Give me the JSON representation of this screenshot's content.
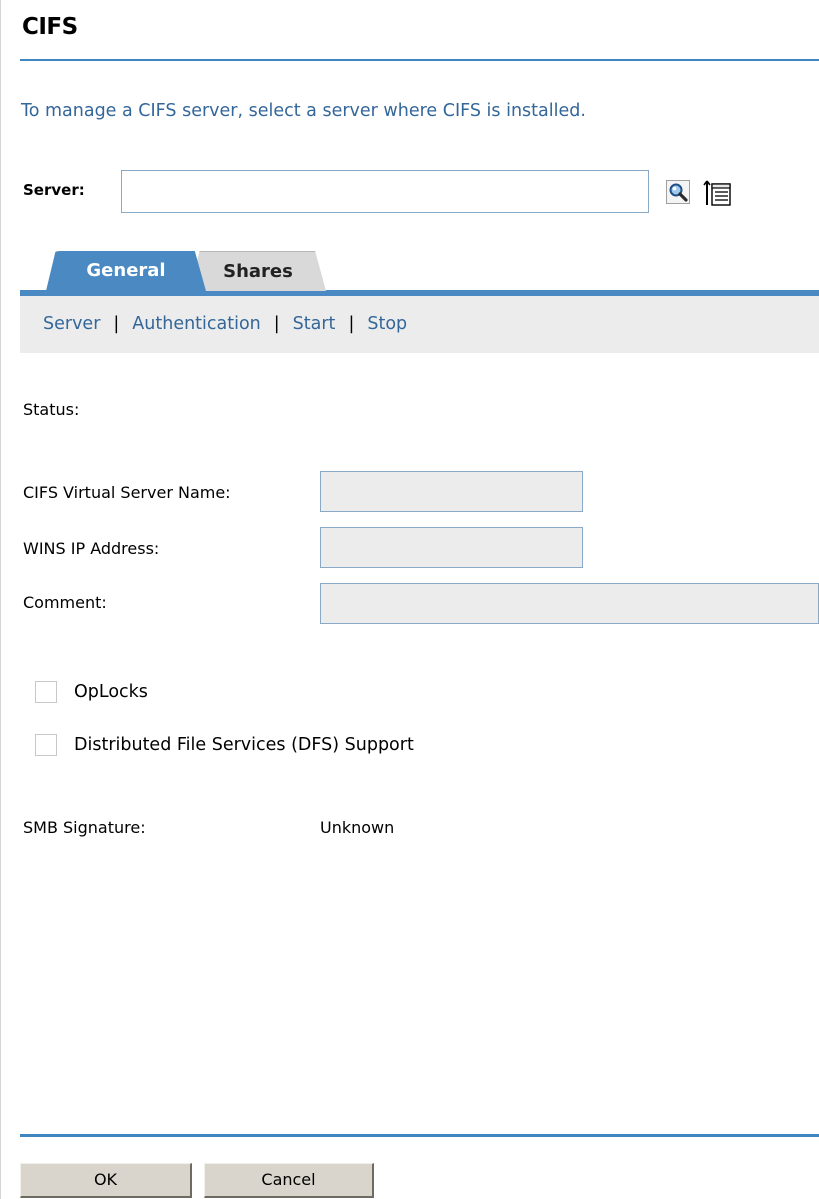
{
  "page": {
    "title": "CIFS",
    "instructions": "To manage a CIFS server, select a server where CIFS is installed."
  },
  "server": {
    "label": "Server:",
    "value": "",
    "search_icon": "magnifier-search-icon",
    "browse_icon": "object-browser-tree-icon"
  },
  "tabs": [
    {
      "label": "General",
      "active": true
    },
    {
      "label": "Shares",
      "active": false
    }
  ],
  "subnav": {
    "items": [
      "Server",
      "Authentication",
      "Start",
      "Stop"
    ],
    "separator": "|"
  },
  "form": {
    "status_label": "Status:",
    "virtual_server_label": "CIFS Virtual Server Name:",
    "virtual_server_value": "",
    "wins_label": "WINS IP Address:",
    "wins_value": "",
    "comment_label": "Comment:",
    "comment_value": "",
    "oplocks_label": "OpLocks",
    "oplocks_checked": false,
    "dfs_label": "Distributed File Services (DFS) Support",
    "dfs_checked": false,
    "smb_label": "SMB Signature:",
    "smb_value": "Unknown"
  },
  "buttons": {
    "ok": "OK",
    "cancel": "Cancel"
  },
  "colors": {
    "accent": "#3f85c0",
    "link": "#336699",
    "tab_active": "#4a89c1",
    "tab_inactive": "#d9d9d9",
    "field_disabled": "#ececec"
  }
}
